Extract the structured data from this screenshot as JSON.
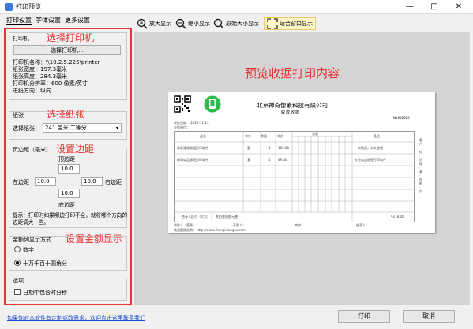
{
  "window": {
    "title": "打印预览",
    "minimize": "—",
    "maximize": "□",
    "close": "✕"
  },
  "tabs": [
    "打印设置",
    "字体设置",
    "更多设置"
  ],
  "toolbar": {
    "zoom_in": "放大显示",
    "zoom_out": "缩小显示",
    "original": "原始大小显示",
    "fit_window": "适合窗口显示"
  },
  "printer_section": {
    "group_label": "打印机",
    "callout": "选择打印机",
    "select_button": "选择打印机...",
    "name": "打印机名称：\\\\10.2.5.225\\printer",
    "paper_width": "纸张宽度：197.3毫米",
    "paper_height": "纸张高度：284.3毫米",
    "resolution": "打印机分辨率：600 像素/英寸",
    "orientation": "进纸方向：纵向"
  },
  "paper_section": {
    "group_label": "纸张",
    "callout": "选择纸张",
    "select_label": "选择纸张：",
    "selected": "241 宝米 二等分"
  },
  "margin_section": {
    "group_label": "页边距（毫米）",
    "callout": "设置边距",
    "top_label": "顶边距",
    "top_value": "10.0",
    "left_label": "左边距",
    "left_value": "10.0",
    "right_label": "右边距",
    "right_value": "10.0",
    "bottom_label": "底边距",
    "bottom_value": "10.0",
    "hint": "提示：打印时如果哪边打印不全，就将哪个方向的边距调大一些。"
  },
  "amount_section": {
    "group_label": "金额列显示方式",
    "callout": "设置金额显示",
    "option1": "数字",
    "option2": "十万千百十圆角分"
  },
  "options_section": {
    "group_label": "选项",
    "checkbox_label": "日期中包含时分秒"
  },
  "preview": {
    "callout": "预览收据打印内容",
    "company": "北京神奇像素科技有限公司",
    "doc_title": "收款收据",
    "number": "No000003",
    "date": "收款日期：  2020-11-13",
    "customer": "交款单位：",
    "headers": [
      "品名",
      "单位",
      "数量",
      "单价",
      "金额",
      "备注"
    ],
    "rows": [
      {
        "name": "神奇通用收据打印软件",
        "unit": "套",
        "qty": "1",
        "price": "169.00",
        "note": "一次购买，永久使用"
      },
      {
        "name": "神奇商品标签打印软件",
        "unit": "套",
        "qty": "1",
        "price": "49.00",
        "note": "专业商品标签打印软件"
      }
    ],
    "total_label": "合计人民币（大写）",
    "total_words": "贰佰壹拾捌元整",
    "total_value": "¥218.00",
    "cashier": "开票人：",
    "receiver": "收款人（签章）：",
    "auditor": "审核：",
    "handler": "经手人：",
    "website": "欢迎惠顾选购！ http://www.shenqixiangsu.com",
    "side_text": "客 户 · 红 · 记 账 · 黄 · 存 根 · 白"
  },
  "bottom": {
    "link": "如果你对本软件有定制或改需求，欢迎点击这里联系我们",
    "print_button": "打印",
    "cancel_button": "取消"
  },
  "colors": {
    "callout": "#e83030",
    "panel_border": "#e33333",
    "link": "#1a4ccc"
  }
}
